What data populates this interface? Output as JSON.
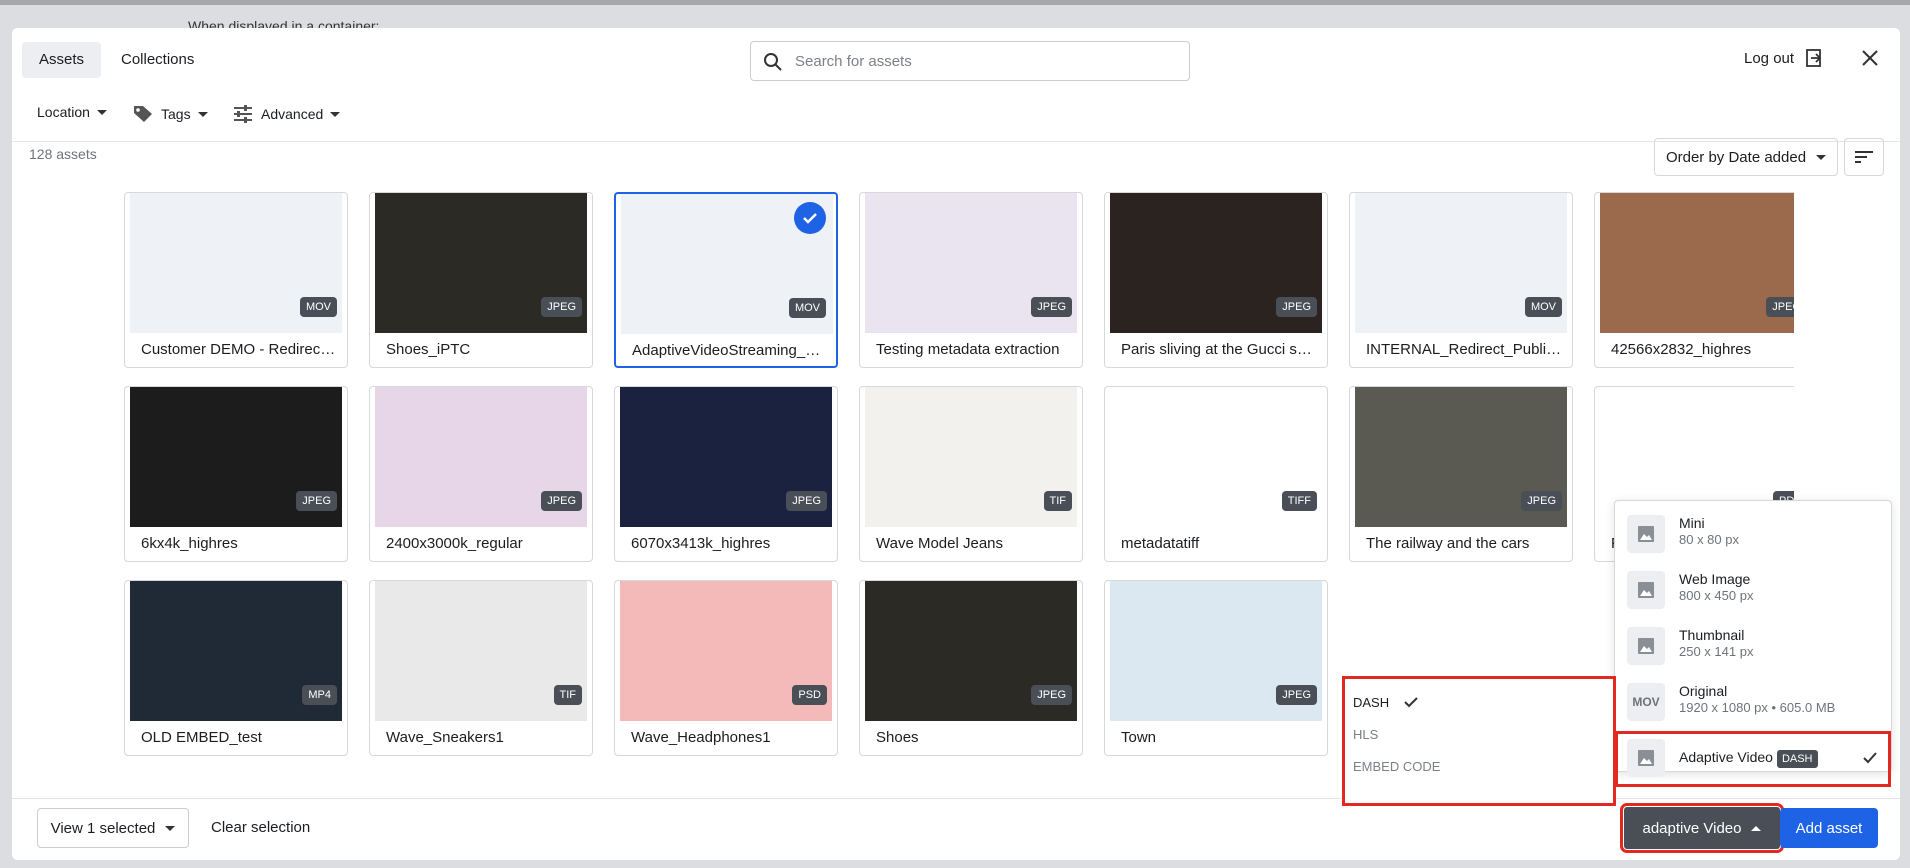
{
  "background": {
    "text": "When displayed in a container:"
  },
  "header": {
    "tabs": [
      {
        "label": "Assets",
        "active": true
      },
      {
        "label": "Collections",
        "active": false
      }
    ],
    "search_placeholder": "Search for assets",
    "logout_label": "Log out",
    "filters": [
      {
        "label": "Location"
      },
      {
        "label": "Tags"
      },
      {
        "label": "Advanced"
      }
    ]
  },
  "toolbar": {
    "asset_count": "128 assets",
    "order_label": "Order by Date added"
  },
  "assets": [
    {
      "name": "Customer DEMO - Redirect Public Links to DAT Preset (Image Optimization)",
      "type": "MOV",
      "selected": false,
      "thumb_color": "#eef1f6"
    },
    {
      "name": "Shoes_iPTC",
      "type": "JPEG",
      "selected": false,
      "thumb_color": "#2c2a24"
    },
    {
      "name": "AdaptiveVideoStreaming_Customer",
      "type": "MOV",
      "selected": true,
      "thumb_color": "#eef1f6"
    },
    {
      "name": "Testing metadata extraction",
      "type": "JPEG",
      "selected": false,
      "thumb_color": "#e9e4ef"
    },
    {
      "name": "Paris sliving at the Gucci show",
      "type": "JPEG",
      "selected": false,
      "thumb_color": "#2b2320"
    },
    {
      "name": "INTERNAL_Redirect_Public_Links",
      "type": "MOV",
      "selected": false,
      "thumb_color": "#eef1f6"
    },
    {
      "name": "42566x2832_highres",
      "type": "JPEG",
      "selected": false,
      "thumb_color": "#9b6a4c"
    },
    {
      "name": "6kx4k_highres",
      "type": "JPEG",
      "selected": false,
      "thumb_color": "#1c1c1c"
    },
    {
      "name": "2400x3000k_regular",
      "type": "JPEG",
      "selected": false,
      "thumb_color": "#e6d6e8"
    },
    {
      "name": "6070x3413k_highres",
      "type": "JPEG",
      "selected": false,
      "thumb_color": "#1a2240"
    },
    {
      "name": "Wave Model Jeans",
      "type": "TIF",
      "selected": false,
      "thumb_color": "#f3f1ee"
    },
    {
      "name": "metadatatiff",
      "type": "TIFF",
      "selected": false,
      "thumb_color": "#ffffff"
    },
    {
      "name": "The railway and the cars",
      "type": "JPEG",
      "selected": false,
      "thumb_color": "#5a5a52"
    },
    {
      "name": "FAQ",
      "type": "PDF",
      "selected": false,
      "thumb_color": "#ffffff"
    },
    {
      "name": "OLD EMBED_test",
      "type": "MP4",
      "selected": false,
      "thumb_color": "#1f2a36"
    },
    {
      "name": "Wave_Sneakers1",
      "type": "TIF",
      "selected": false,
      "thumb_color": "#e9e9e9"
    },
    {
      "name": "Wave_Headphones1",
      "type": "PSD",
      "selected": false,
      "thumb_color": "#f4b9b9"
    },
    {
      "name": "Shoes",
      "type": "JPEG",
      "selected": false,
      "thumb_color": "#2c2a24"
    },
    {
      "name": "Town",
      "type": "JPEG",
      "selected": false,
      "thumb_color": "#dbe8f2"
    }
  ],
  "footer": {
    "view_selected_label": "View 1 selected",
    "clear_label": "Clear selection",
    "format_button_label": "adaptive Video",
    "add_button_label": "Add asset"
  },
  "format_menu": [
    {
      "name": "Mini",
      "desc": "80 x 80 px",
      "icon": "image-icon"
    },
    {
      "name": "Web Image",
      "desc": "800 x 450 px",
      "icon": "image-icon"
    },
    {
      "name": "Thumbnail",
      "desc": "250 x 141 px",
      "icon": "image-icon"
    },
    {
      "name": "Original",
      "desc": "1920 x 1080 px  •  605.0 MB",
      "icon": "MOV"
    },
    {
      "name": "Adaptive Video",
      "tag": "DASH",
      "icon": "image-icon",
      "selected": true
    }
  ],
  "stream_menu": [
    {
      "label": "DASH",
      "checked": true
    },
    {
      "label": "HLS",
      "checked": false
    },
    {
      "label": "EMBED CODE",
      "checked": false
    }
  ],
  "colors": {
    "accent": "#1e63e6",
    "highlight": "#e2281f",
    "badge": "#4a4f57"
  }
}
